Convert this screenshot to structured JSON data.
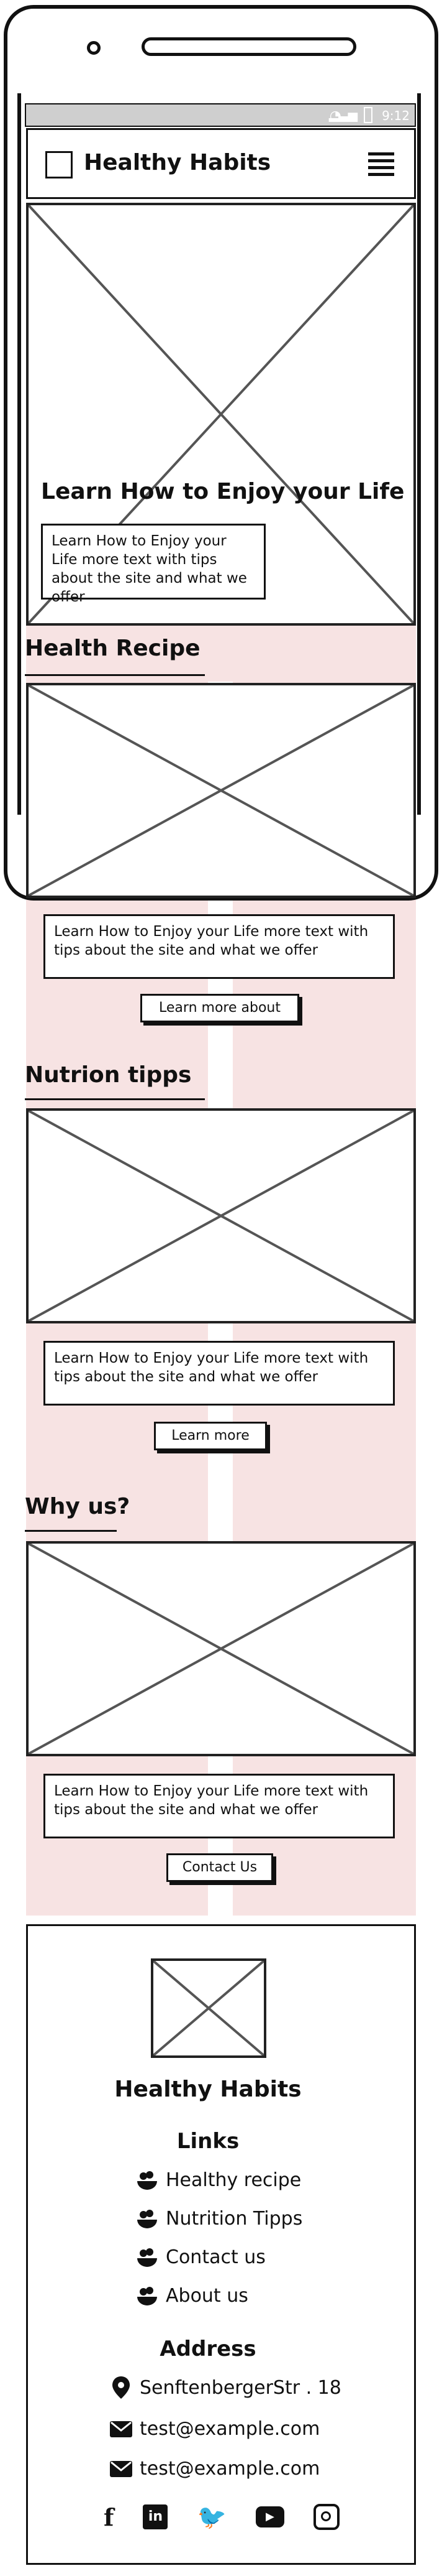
{
  "status_bar": {
    "time": "9:12"
  },
  "header": {
    "brand": "Healthy Habits",
    "menu_icon": "hamburger-menu-icon"
  },
  "hero": {
    "title": "Learn How to Enjoy your Life",
    "text": "Learn How to Enjoy your Life more text with tips about the site and what we offer"
  },
  "sections": [
    {
      "title": "Health Recipe",
      "text": "Learn How to Enjoy your Life more text with tips about the site and what we offer",
      "button": "Learn more about"
    },
    {
      "title": "Nutrion tipps",
      "text": "Learn How to Enjoy your Life more text with tips about the site and what we offer",
      "button": "Learn more"
    },
    {
      "title": "Why us?",
      "text": "Learn How to Enjoy your Life more text with tips about the site and what we offer",
      "button": "Contact Us"
    }
  ],
  "footer": {
    "brand": "Healthy Habits",
    "links_title": "Links",
    "links": [
      "Healthy recipe",
      "Nutrition Tipps",
      "Contact us",
      "About us"
    ],
    "address_title": "Address",
    "address": "SenftenbergerStr . 18",
    "emails": [
      "test@example.com",
      "test@example.com"
    ],
    "social_icons": [
      "facebook-icon",
      "linkedin-icon",
      "twitter-icon",
      "youtube-icon",
      "instagram-icon"
    ]
  },
  "colors": {
    "section_background": "#f7e3e3",
    "ink": "#111111"
  }
}
